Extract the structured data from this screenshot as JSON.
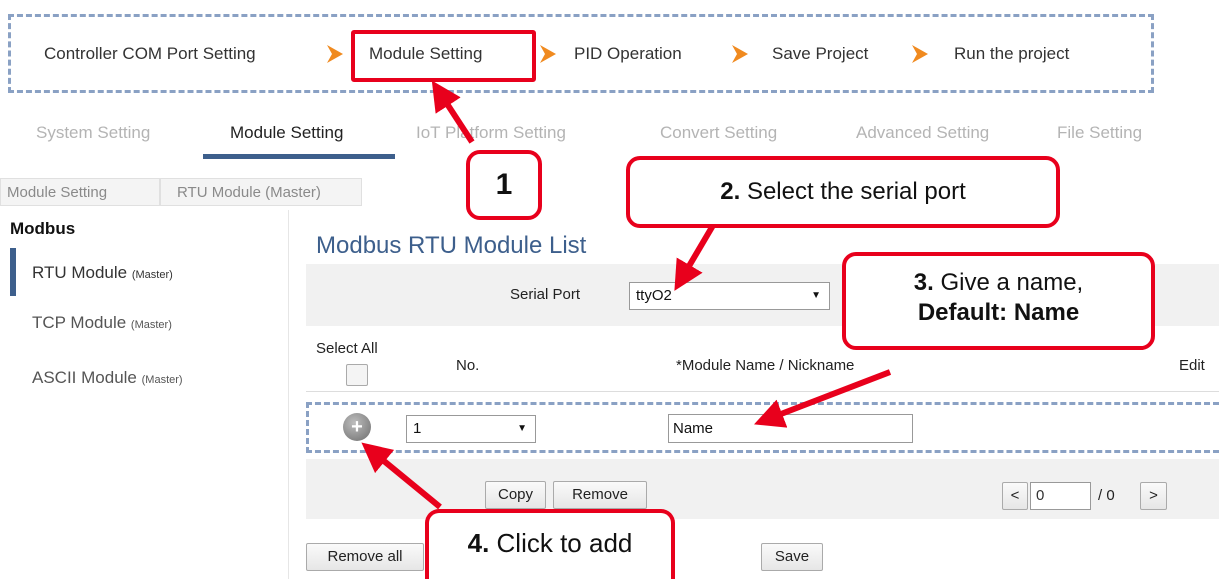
{
  "wizard": {
    "steps": [
      "Controller COM Port Setting",
      "Module Setting",
      "PID Operation",
      "Save Project",
      "Run the project"
    ],
    "arrow_color": "#f08a1f",
    "highlight_color": "#e8001c"
  },
  "tabs": [
    "System Setting",
    "Module Setting",
    "IoT Platform Setting",
    "Convert Setting",
    "Advanced Setting",
    "File Setting"
  ],
  "active_tab": "Module Setting",
  "breadcrumb": [
    "Module Setting",
    "RTU Module (Master)"
  ],
  "sidebar": {
    "title": "Modbus",
    "items": [
      {
        "label": "RTU Module",
        "suffix": "(Master)",
        "active": true
      },
      {
        "label": "TCP Module",
        "suffix": "(Master)",
        "active": false
      },
      {
        "label": "ASCII Module",
        "suffix": "(Master)",
        "active": false
      }
    ]
  },
  "main": {
    "title": "Modbus RTU Module List",
    "serial_port_label": "Serial Port",
    "serial_port_value": "ttyO2",
    "columns": {
      "select_all": "Select All",
      "no": "No.",
      "module_name": "*Module Name / Nickname",
      "edit": "Edit"
    },
    "row": {
      "no_value": "1",
      "name_value": "Name"
    },
    "buttons": {
      "copy": "Copy",
      "remove": "Remove",
      "remove_all": "Remove all",
      "save": "Save",
      "prev": "<",
      "next": ">"
    },
    "pagination": {
      "current": "0",
      "total": "/ 0"
    }
  },
  "annotations": {
    "step1": "1",
    "step2_num": "2.",
    "step2_text": "Select the serial port",
    "step3_num": "3.",
    "step3_text": "Give a name,",
    "step3_default": "Default: Name",
    "step4_num": "4.",
    "step4_text": "Click to add",
    "color": "#e8001c"
  }
}
